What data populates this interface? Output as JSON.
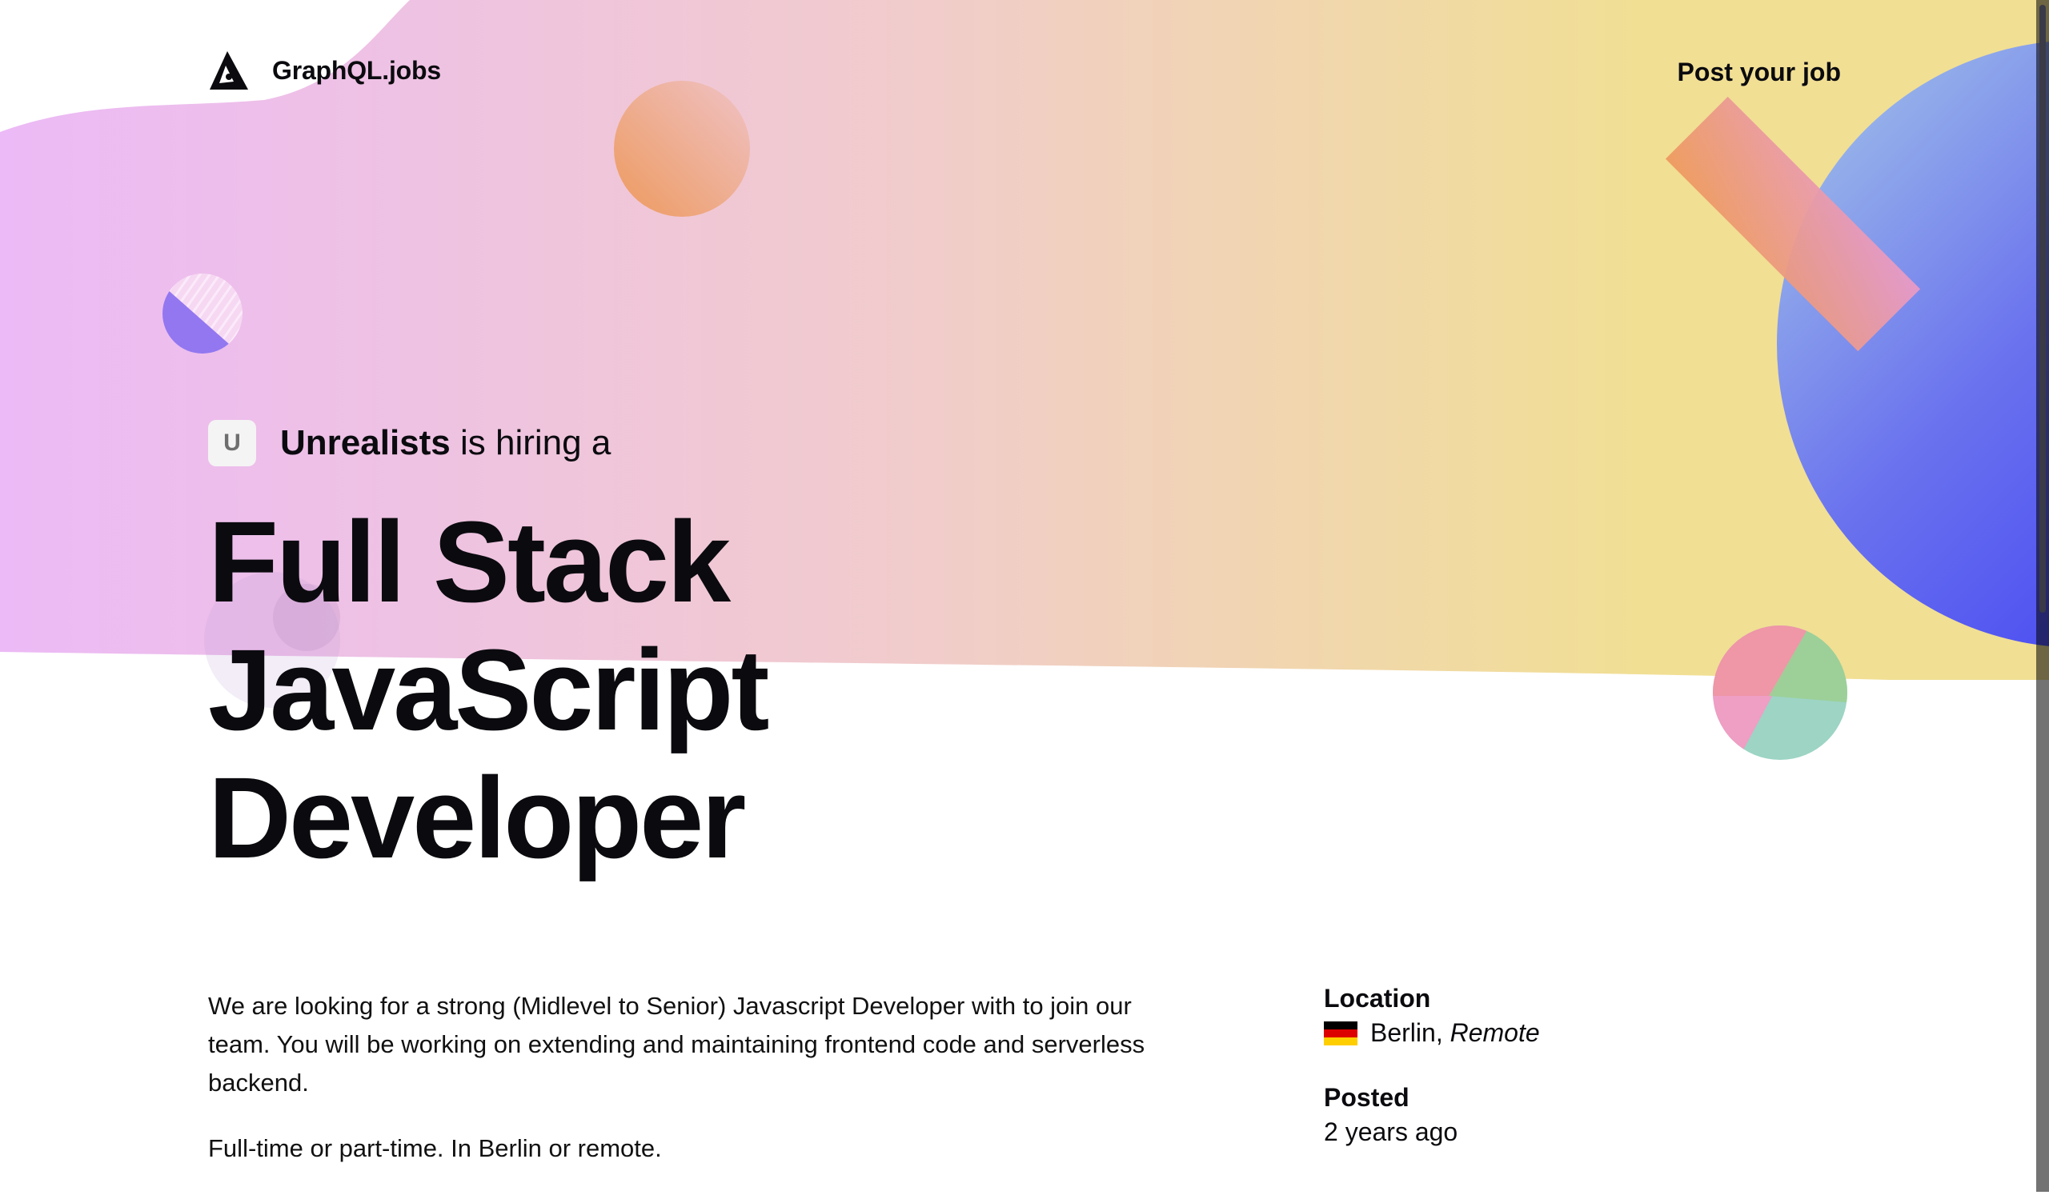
{
  "header": {
    "brand_name": "GraphQL.jobs",
    "post_job_label": "Post your job"
  },
  "hero": {
    "company_initial": "U",
    "company_name": "Unrealists",
    "hiring_text": "is hiring a",
    "job_title_lines": [
      "Full Stack",
      "JavaScript",
      "Developer"
    ]
  },
  "description": {
    "paragraphs": [
      "We are looking for a strong (Midlevel to Senior) Javascript Developer with to join our team. You will be working on extending and maintaining frontend code and serverless backend.",
      "Full-time or part-time. In Berlin or remote."
    ]
  },
  "meta": {
    "location_label": "Location",
    "location_city": "Berlin,",
    "location_remote": "Remote",
    "flag_icon": "germany-flag-icon",
    "posted_label": "Posted",
    "posted_value": "2 years ago"
  },
  "colors": {
    "gradient_start": "#ecbaf6",
    "gradient_mid": "#f1cccb",
    "gradient_end": "#f1df94",
    "blue_blob": "#3431f4",
    "text": "#0b0b0f"
  }
}
